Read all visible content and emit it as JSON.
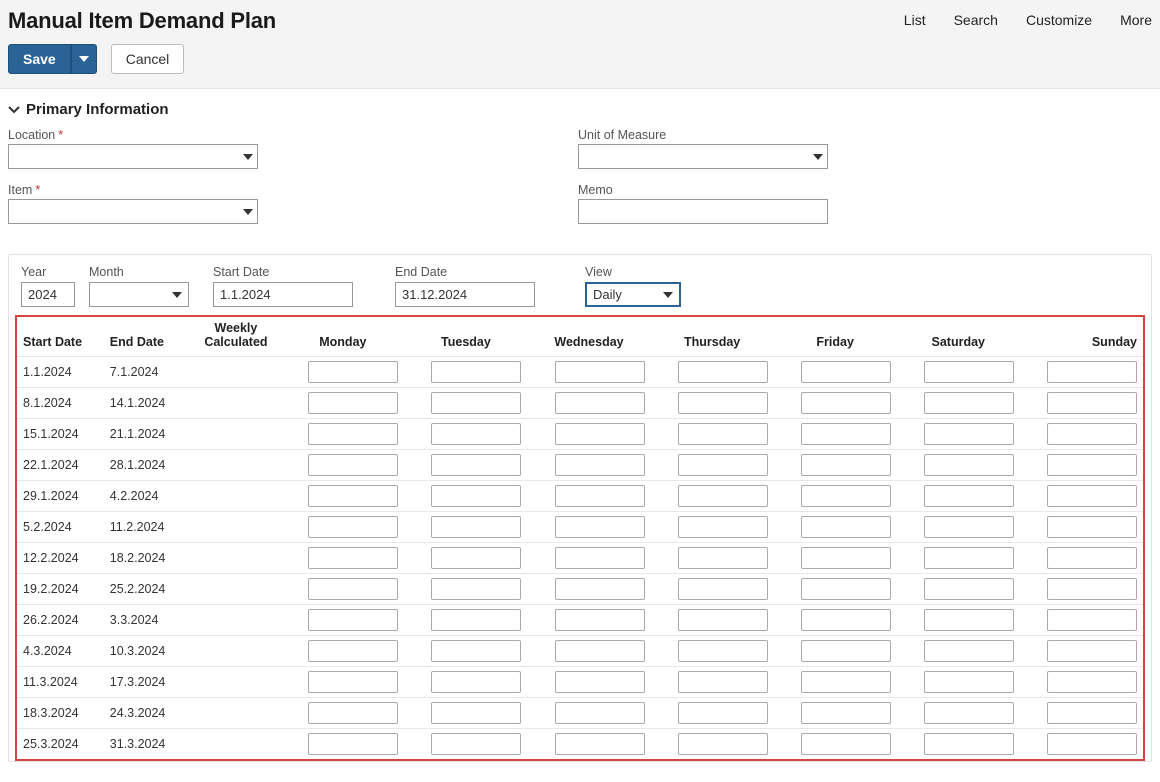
{
  "header": {
    "title": "Manual Item Demand Plan",
    "nav": [
      "List",
      "Search",
      "Customize",
      "More"
    ],
    "save": "Save",
    "cancel": "Cancel"
  },
  "section": {
    "title": "Primary Information",
    "fields": {
      "location_label": "Location",
      "item_label": "Item",
      "uom_label": "Unit of Measure",
      "memo_label": "Memo"
    }
  },
  "filters": {
    "year_label": "Year",
    "month_label": "Month",
    "start_label": "Start Date",
    "end_label": "End Date",
    "view_label": "View",
    "year_value": "2024",
    "month_value": "",
    "start_value": "1.1.2024",
    "end_value": "31.12.2024",
    "view_value": "Daily"
  },
  "columns": {
    "start": "Start Date",
    "end": "End Date",
    "weekly": "Weekly Calculated",
    "mon": "Monday",
    "tue": "Tuesday",
    "wed": "Wednesday",
    "thu": "Thursday",
    "fri": "Friday",
    "sat": "Saturday",
    "sun": "Sunday"
  },
  "rows": [
    {
      "start": "1.1.2024",
      "end": "7.1.2024"
    },
    {
      "start": "8.1.2024",
      "end": "14.1.2024"
    },
    {
      "start": "15.1.2024",
      "end": "21.1.2024"
    },
    {
      "start": "22.1.2024",
      "end": "28.1.2024"
    },
    {
      "start": "29.1.2024",
      "end": "4.2.2024"
    },
    {
      "start": "5.2.2024",
      "end": "11.2.2024"
    },
    {
      "start": "12.2.2024",
      "end": "18.2.2024"
    },
    {
      "start": "19.2.2024",
      "end": "25.2.2024"
    },
    {
      "start": "26.2.2024",
      "end": "3.3.2024"
    },
    {
      "start": "4.3.2024",
      "end": "10.3.2024"
    },
    {
      "start": "11.3.2024",
      "end": "17.3.2024"
    },
    {
      "start": "18.3.2024",
      "end": "24.3.2024"
    },
    {
      "start": "25.3.2024",
      "end": "31.3.2024"
    }
  ]
}
